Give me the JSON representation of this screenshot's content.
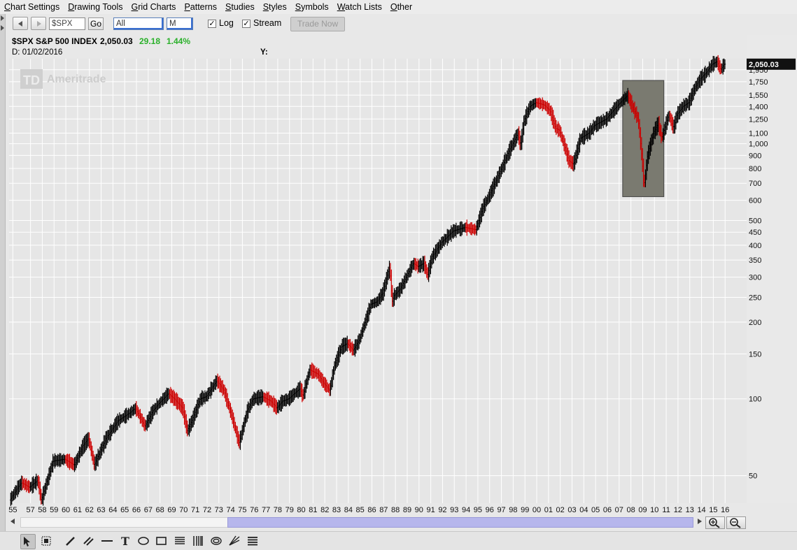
{
  "menubar": {
    "items": [
      {
        "label": "Chart Settings",
        "accel": "C",
        "rest": "hart Settings"
      },
      {
        "label": "Drawing Tools",
        "accel": "D",
        "rest": "rawing Tools"
      },
      {
        "label": "Grid Charts",
        "accel": "G",
        "rest": "rid Charts"
      },
      {
        "label": "Patterns",
        "accel": "P",
        "rest": "atterns"
      },
      {
        "label": "Studies",
        "accel": "S",
        "rest": "tudies"
      },
      {
        "label": "Styles",
        "accel": "S",
        "rest": "tyles"
      },
      {
        "label": "Symbols",
        "accel": "S",
        "rest": "ymbols"
      },
      {
        "label": "Watch Lists",
        "accel": "W",
        "rest": "atch Lists"
      },
      {
        "label": "Other",
        "accel": "O",
        "rest": "ther"
      }
    ]
  },
  "toolbar": {
    "symbol_value": "$SPX",
    "go_label": "Go",
    "period_value": "All",
    "interval_value": "M",
    "log_label": "Log",
    "log_checked": true,
    "stream_label": "Stream",
    "stream_checked": true,
    "trade_now_label": "Trade Now"
  },
  "quote": {
    "symbol_name": "$SPX S&P 500 INDEX",
    "last": "2,050.03",
    "change": "29.18",
    "change_pct": "1.44%",
    "change_color": "#2ab02a",
    "date_label": "D: 01/02/2016",
    "y_label": "Y:"
  },
  "watermark": "Ameritrade",
  "watermark_logo": "TD",
  "price_tag": "2,050.03",
  "icons": {
    "scroll_left": "left-arrow-icon",
    "scroll_right": "right-arrow-icon",
    "zoom_in": "zoom-in-icon",
    "zoom_out": "zoom-out-icon"
  },
  "colors": {
    "up_bar": "#000000",
    "down_bar": "#cc0000",
    "highlight_box": "#7a7a70",
    "grid": "#ffffff",
    "price_tag_bg": "#111111",
    "scroll_thumb": "#b6b6ec"
  },
  "chart_data": {
    "type": "line",
    "title": "$SPX S&P 500 INDEX",
    "log_scale": true,
    "grid": true,
    "ylim": [
      40,
      2100
    ],
    "y_ticks": [
      50,
      100,
      150,
      200,
      250,
      300,
      350,
      400,
      450,
      500,
      600,
      700,
      800,
      900,
      1000,
      1100,
      1250,
      1400,
      1550,
      1750,
      1950
    ],
    "y_tick_labels": [
      "50",
      "100",
      "150",
      "200",
      "250",
      "300",
      "350",
      "400",
      "450",
      "500",
      "600",
      "700",
      "800",
      "900",
      "1,000",
      "1,100",
      "1,250",
      "1,400",
      "1,550",
      "1,750",
      "1,950"
    ],
    "x_tick_labels": [
      "55",
      "57",
      "58",
      "59",
      "60",
      "61",
      "62",
      "63",
      "64",
      "65",
      "66",
      "67",
      "68",
      "69",
      "70",
      "71",
      "72",
      "73",
      "74",
      "75",
      "76",
      "77",
      "78",
      "79",
      "80",
      "81",
      "82",
      "83",
      "84",
      "85",
      "86",
      "87",
      "88",
      "89",
      "90",
      "91",
      "92",
      "93",
      "94",
      "95",
      "96",
      "97",
      "98",
      "99",
      "00",
      "01",
      "02",
      "03",
      "04",
      "05",
      "06",
      "07",
      "08",
      "09",
      "10",
      "11",
      "12",
      "13",
      "14",
      "15",
      "16"
    ],
    "x_tick_years": [
      1955.5,
      1957,
      1958,
      1959,
      1960,
      1961,
      1962,
      1963,
      1964,
      1965,
      1966,
      1967,
      1968,
      1969,
      1970,
      1971,
      1972,
      1973,
      1974,
      1975,
      1976,
      1977,
      1978,
      1979,
      1980,
      1981,
      1982,
      1983,
      1984,
      1985,
      1986,
      1987,
      1988,
      1989,
      1990,
      1991,
      1992,
      1993,
      1994,
      1995,
      1996,
      1997,
      1998,
      1999,
      2000,
      2001,
      2002,
      2003,
      2004,
      2005,
      2006,
      2007,
      2008,
      2009,
      2010,
      2011,
      2012,
      2013,
      2014,
      2015,
      2016
    ],
    "xlim": [
      1955.3,
      2016.7
    ],
    "series": [
      {
        "values_x": [
          1955.3,
          1956.3,
          1957.0,
          1957.7,
          1958.0,
          1959.0,
          1960.0,
          1960.8,
          1961.5,
          1962.0,
          1962.5,
          1963.5,
          1964.5,
          1965.5,
          1966.0,
          1966.8,
          1967.5,
          1968.0,
          1968.8,
          1969.3,
          1970.0,
          1970.4,
          1970.8,
          1971.5,
          1972.0,
          1972.9,
          1973.5,
          1974.2,
          1974.8,
          1975.5,
          1976.0,
          1976.8,
          1977.5,
          1978.0,
          1978.5,
          1979.0,
          1980.0,
          1980.2,
          1980.8,
          1981.5,
          1982.0,
          1982.5,
          1982.9,
          1983.5,
          1984.0,
          1984.5,
          1985.0,
          1986.0,
          1986.5,
          1987.0,
          1987.6,
          1987.8,
          1988.0,
          1988.5,
          1989.0,
          1989.6,
          1990.0,
          1990.5,
          1990.8,
          1991.2,
          1992.0,
          1993.0,
          1994.0,
          1994.9,
          1995.5,
          1996.0,
          1997.0,
          1997.8,
          1998.5,
          1998.7,
          1999.0,
          1999.5,
          2000.0,
          2000.7,
          2001.2,
          2001.7,
          2002.0,
          2002.5,
          2002.8,
          2003.2,
          2003.8,
          2004.5,
          2005.0,
          2006.0,
          2007.0,
          2007.8,
          2008.2,
          2008.7,
          2009.0,
          2009.2,
          2009.5,
          2010.0,
          2010.4,
          2010.7,
          2011.3,
          2011.7,
          2012.0,
          2012.5,
          2013.0,
          2013.5,
          2014.0,
          2014.5,
          2015.0,
          2015.4,
          2015.7,
          2016.0
        ],
        "values_y": [
          40,
          47,
          45,
          48,
          40,
          57,
          58,
          55,
          65,
          70,
          55,
          70,
          82,
          88,
          92,
          78,
          90,
          96,
          105,
          100,
          92,
          75,
          82,
          100,
          102,
          118,
          108,
          85,
          67,
          90,
          100,
          102,
          98,
          92,
          98,
          100,
          110,
          102,
          130,
          125,
          115,
          108,
          135,
          160,
          165,
          155,
          170,
          235,
          240,
          260,
          330,
          240,
          255,
          270,
          300,
          340,
          330,
          340,
          305,
          360,
          410,
          455,
          470,
          460,
          560,
          620,
          780,
          950,
          1100,
          980,
          1230,
          1400,
          1450,
          1420,
          1350,
          1150,
          1130,
          960,
          860,
          830,
          1050,
          1100,
          1180,
          1250,
          1420,
          1550,
          1400,
          1250,
          900,
          680,
          900,
          1100,
          1200,
          1050,
          1300,
          1150,
          1300,
          1400,
          1450,
          1650,
          1800,
          1900,
          2050,
          2100,
          1950,
          2050
        ]
      }
    ],
    "annotations": [
      {
        "type": "highlight-box",
        "from_year": 2007.3,
        "to_year": 2010.8,
        "from_value": 620,
        "to_value": 1770
      }
    ]
  }
}
